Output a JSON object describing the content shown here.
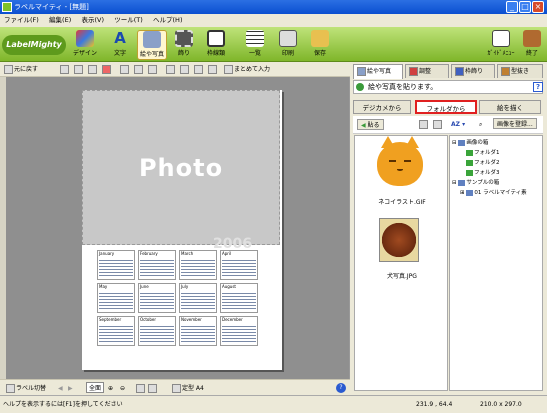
{
  "window": {
    "title": "ラベルマイティ - [無題]"
  },
  "menu": [
    "ファイル(F)",
    "編集(E)",
    "表示(V)",
    "ツール(T)",
    "ヘルプ(H)"
  ],
  "toolbar": {
    "logo": "LabelMighty",
    "items": [
      "デザイン",
      "文字",
      "絵や写真",
      "飾り",
      "枠線類",
      "一覧",
      "印刷",
      "保存"
    ],
    "right": [
      "ｶﾞｲﾄﾞﾒﾆｭｰ",
      "終了"
    ]
  },
  "subtoolbar": {
    "undo": "元に戻す",
    "bulk_input": "まとめて入力"
  },
  "canvas": {
    "photo_label": "Photo",
    "year": "2006",
    "months": [
      "January",
      "February",
      "March",
      "April",
      "May",
      "June",
      "July",
      "August",
      "September",
      "October",
      "November",
      "December"
    ]
  },
  "bottombar": {
    "label_switch": "ラベル切替",
    "zoom_all": "全面",
    "paper": "定型 A4"
  },
  "statusbar": {
    "help": "ヘルプを表示するには[F1]を押してください",
    "coords": "231.9 , 64.4",
    "size": "210.0 x 297.0"
  },
  "rightpanel": {
    "tabs": [
      "絵や写真",
      "調整",
      "枠飾り",
      "型抜き"
    ],
    "info": "絵や写真を貼ります。",
    "help_btn": "?",
    "sub_tabs": [
      "デジカメから",
      "フォルダから",
      "絵を描く"
    ],
    "paste": "貼る",
    "register": "画像を登録...",
    "sort_label": "AZ",
    "thumbnails": [
      {
        "caption": "ネコイラスト.GIF"
      },
      {
        "caption": "犬写真.JPG"
      }
    ],
    "tree": [
      {
        "label": "画像の箱",
        "level": 0
      },
      {
        "label": "フォルダ1",
        "level": 1
      },
      {
        "label": "フォルダ2",
        "level": 1
      },
      {
        "label": "フォルダ3",
        "level": 1
      },
      {
        "label": "サンプルの箱",
        "level": 0
      },
      {
        "label": "01 ラベルマイティ素",
        "level": 1
      }
    ]
  },
  "colors": {
    "accent_green": "#7fb62a",
    "highlight_red": "#e02020",
    "titlebar_blue": "#0a4fd0"
  }
}
